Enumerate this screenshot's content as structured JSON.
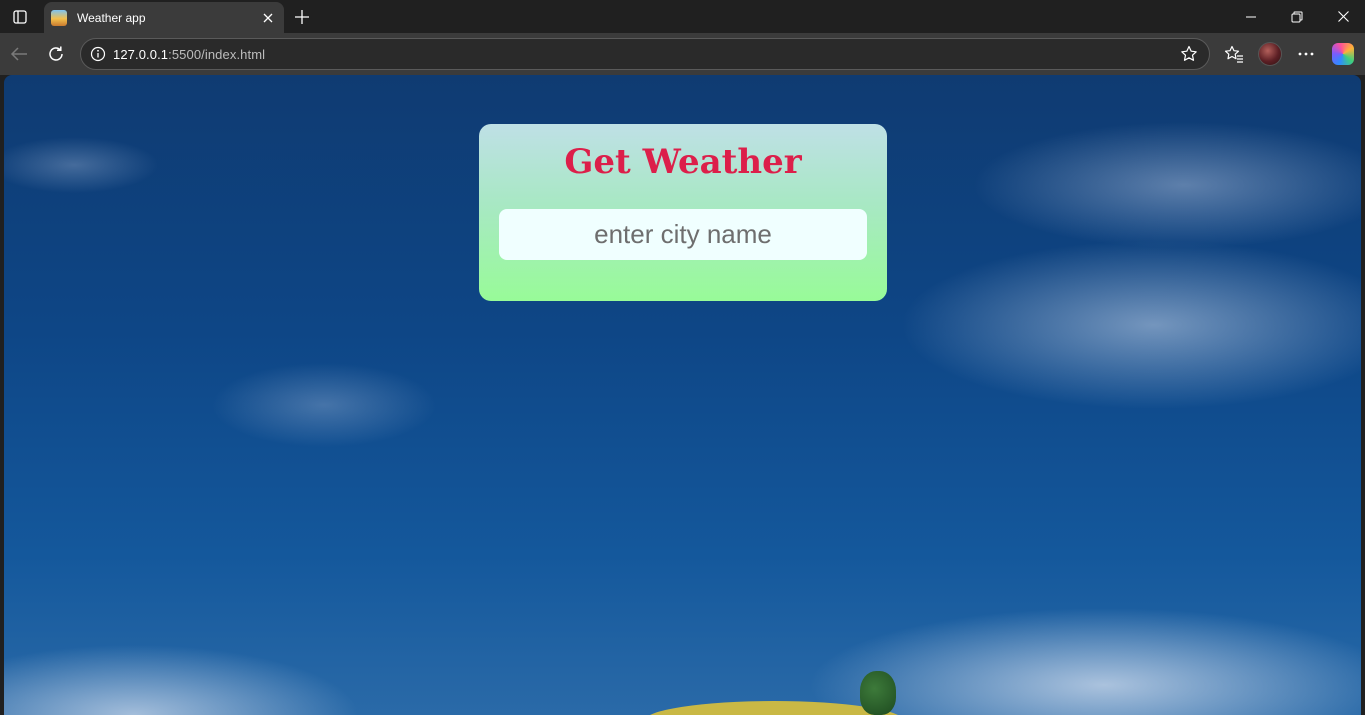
{
  "browser": {
    "tab": {
      "title": "Weather app"
    },
    "address_bar": {
      "url_host": "127.0.0.1",
      "url_rest": ":5500/index.html"
    }
  },
  "page": {
    "card": {
      "title": "Get Weather",
      "city_input": {
        "placeholder": "enter city name",
        "value": ""
      }
    }
  },
  "colors": {
    "card_title": "#dc1f4a",
    "card_gradient_top": "#bfe0e6",
    "card_gradient_bottom": "#98fb98",
    "input_background": "#f0ffff"
  },
  "icons": [
    "tab-actions-icon",
    "close-icon",
    "plus-icon",
    "minimize-icon",
    "restore-icon",
    "back-arrow-icon",
    "reload-icon",
    "info-icon",
    "star-icon",
    "favorites-icon",
    "more-icon",
    "copilot-icon"
  ]
}
